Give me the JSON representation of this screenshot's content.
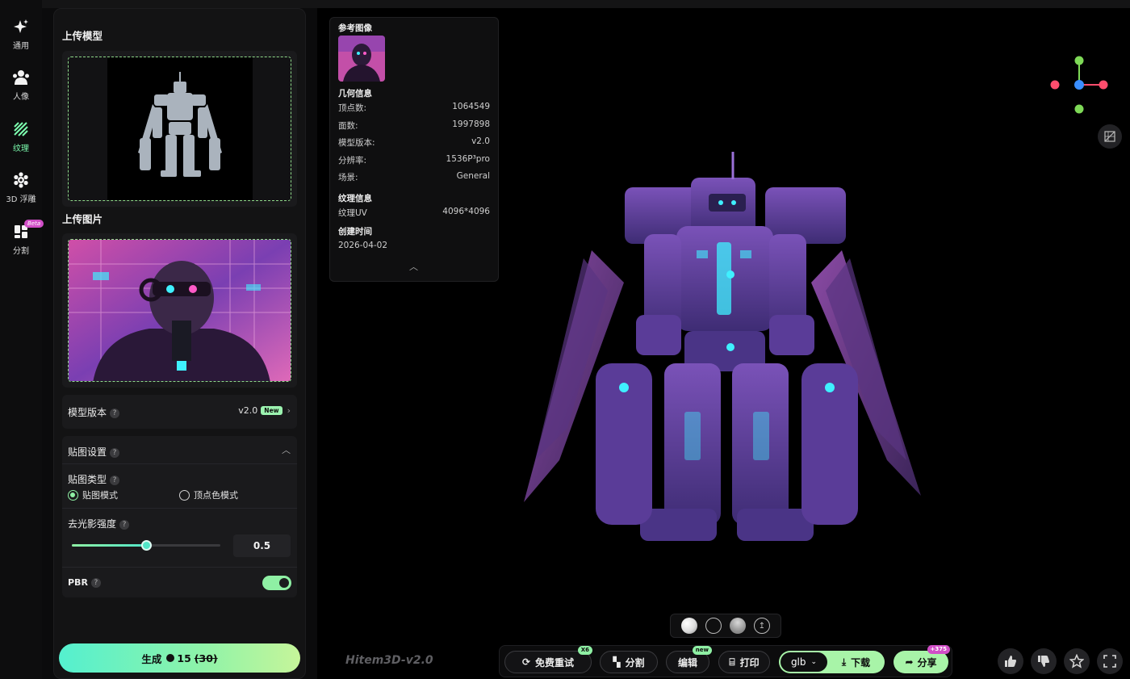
{
  "rail": [
    {
      "label": "通用",
      "icon": "sparkle-icon"
    },
    {
      "label": "人像",
      "icon": "people-icon"
    },
    {
      "label": "纹理",
      "icon": "texture-icon"
    },
    {
      "label": "3D 浮雕",
      "icon": "relief-icon"
    },
    {
      "label": "分割",
      "icon": "split-icon",
      "badge": "Beta"
    }
  ],
  "panel": {
    "upload_model_title": "上传模型",
    "upload_image_title": "上传图片",
    "model_version": {
      "label": "模型版本",
      "value": "v2.0",
      "badge": "New"
    },
    "texture_settings": {
      "label": "贴图设置"
    },
    "texture_type": {
      "label": "贴图类型",
      "options": [
        "贴图模式",
        "顶点色模式"
      ],
      "selected": "贴图模式"
    },
    "delight": {
      "label": "去光影强度",
      "value": "0.5",
      "fraction": 0.5
    },
    "pbr": {
      "label": "PBR",
      "enabled": true
    },
    "generate": {
      "label": "生成",
      "cost": "15",
      "original_cost": "(30)"
    }
  },
  "info": {
    "ref_title": "参考图像",
    "geo_title": "几何信息",
    "geo": [
      {
        "k": "顶点数:",
        "v": "1064549"
      },
      {
        "k": "面数:",
        "v": "1997898"
      },
      {
        "k": "模型版本:",
        "v": "v2.0"
      },
      {
        "k": "分辨率:",
        "v": "1536P³pro"
      },
      {
        "k": "场景:",
        "v": "General"
      }
    ],
    "tex_title": "纹理信息",
    "tex": [
      {
        "k": "纹理UV",
        "v": "4096*4096"
      }
    ],
    "date_title": "创建时间",
    "date": "2026-04-02"
  },
  "brand": "Hitem3D-v2.0",
  "toolbar": {
    "retry": {
      "label": "免费重试",
      "tag": "X6"
    },
    "split": {
      "label": "分割"
    },
    "edit": {
      "label": "编辑",
      "tag": "new"
    },
    "print": {
      "label": "打印"
    },
    "format": "glb",
    "download": "下载",
    "share": {
      "label": "分享",
      "tag": "+375"
    }
  },
  "colors": {
    "accent": "#8ff0a4",
    "accent2": "#54f0cf",
    "robot": "#6a3fa0",
    "glow": "#3ff0ff"
  }
}
